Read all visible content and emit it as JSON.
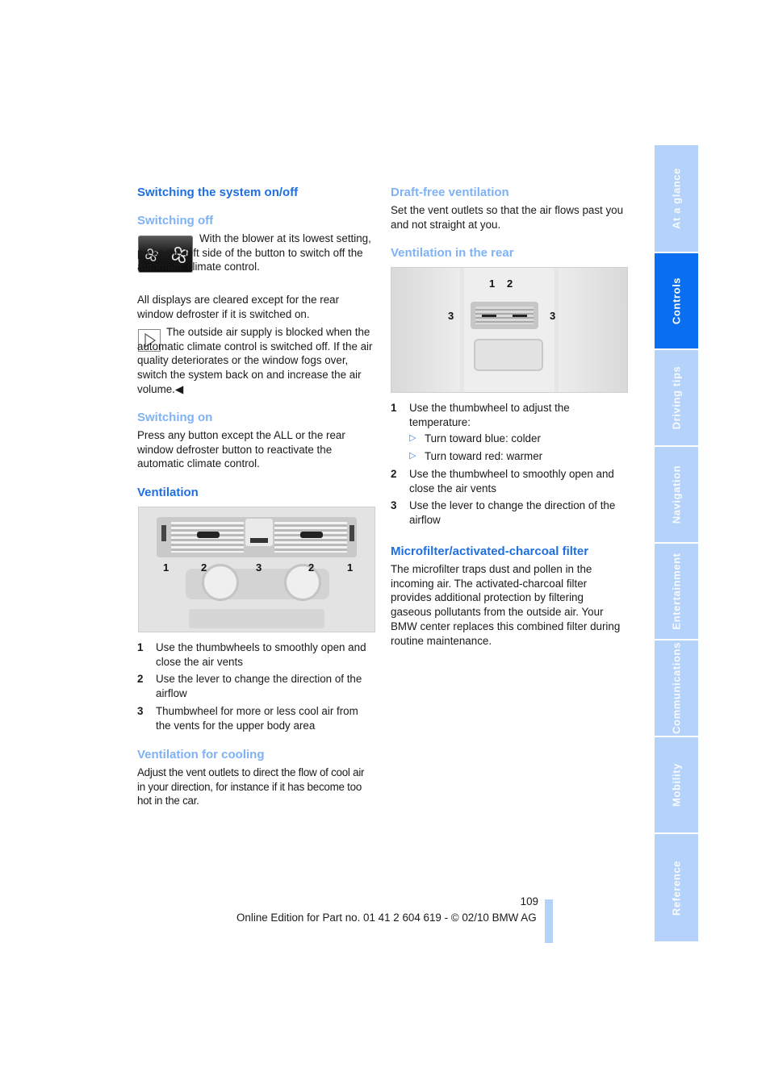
{
  "left_column": {
    "section_title": "Switching the system on/off",
    "switching_off": {
      "heading": "Switching off",
      "button_image_icon": "blower-fan-button",
      "text_1": "With the blower at its lowest setting, press the left side of the button to switch off the automatic climate control.",
      "text_2": "All displays are cleared except for the rear window defroster if it is switched on.",
      "note_icon": "note-triangle",
      "note_text": "The outside air supply is blocked when the automatic climate control is switched off. If the air quality deteriorates or the window fogs over, switch the system back on and increase the air volume.",
      "note_end_marker": "◀"
    },
    "switching_on": {
      "heading": "Switching on",
      "text": "Press any button except the ALL or the rear window defroster button to reactivate the automatic climate control."
    },
    "ventilation": {
      "heading": "Ventilation",
      "figure_labels": [
        "1",
        "2",
        "3",
        "2",
        "1"
      ],
      "items": [
        {
          "num": "1",
          "text": "Use the thumbwheels to smoothly open and close the air vents"
        },
        {
          "num": "2",
          "text": "Use the lever to change the direction of the airflow"
        },
        {
          "num": "3",
          "text": "Thumbwheel for more or less cool air from the vents for the upper body area"
        }
      ]
    },
    "ventilation_cooling": {
      "heading": "Ventilation for cooling",
      "text": "Adjust the vent outlets to direct the flow of cool air in your direction, for instance if it has become too hot in the car."
    }
  },
  "right_column": {
    "draft_free": {
      "heading": "Draft-free ventilation",
      "text": "Set the vent outlets so that the air flows past you and not straight at you."
    },
    "rear_ventilation": {
      "heading": "Ventilation in the rear",
      "figure_labels": [
        "1",
        "2",
        "3",
        "3"
      ],
      "items": [
        {
          "num": "1",
          "text": "Use the thumbwheel to adjust the temperature:",
          "bullets": [
            "Turn toward blue: colder",
            "Turn toward red: warmer"
          ]
        },
        {
          "num": "2",
          "text": "Use the thumbwheel to smoothly open and close the air vents"
        },
        {
          "num": "3",
          "text": "Use the lever to change the direction of the airflow"
        }
      ]
    },
    "microfilter": {
      "heading": "Microfilter/activated-charcoal filter",
      "text": "The microfilter traps dust and pollen in the incoming air. The activated-charcoal filter provides additional protection by filtering gaseous pollutants from the outside air. Your BMW center replaces this combined filter during routine maintenance."
    }
  },
  "footer": {
    "page_number": "109",
    "edition": "Online Edition for Part no. 01 41 2 604 619 - © 02/10 BMW AG"
  },
  "side_tabs": [
    {
      "label": "At a glance",
      "active": false
    },
    {
      "label": "Controls",
      "active": true
    },
    {
      "label": "Driving tips",
      "active": false
    },
    {
      "label": "Navigation",
      "active": false
    },
    {
      "label": "Entertainment",
      "active": false
    },
    {
      "label": "Communications",
      "active": false
    },
    {
      "label": "Mobility",
      "active": false
    },
    {
      "label": "Reference",
      "active": false
    }
  ],
  "colors": {
    "heading_main": "#1f6fe0",
    "heading_sub": "#7fb2f5",
    "tab_active": "#0a6ef0",
    "tab_inactive": "#b4d2fa"
  }
}
